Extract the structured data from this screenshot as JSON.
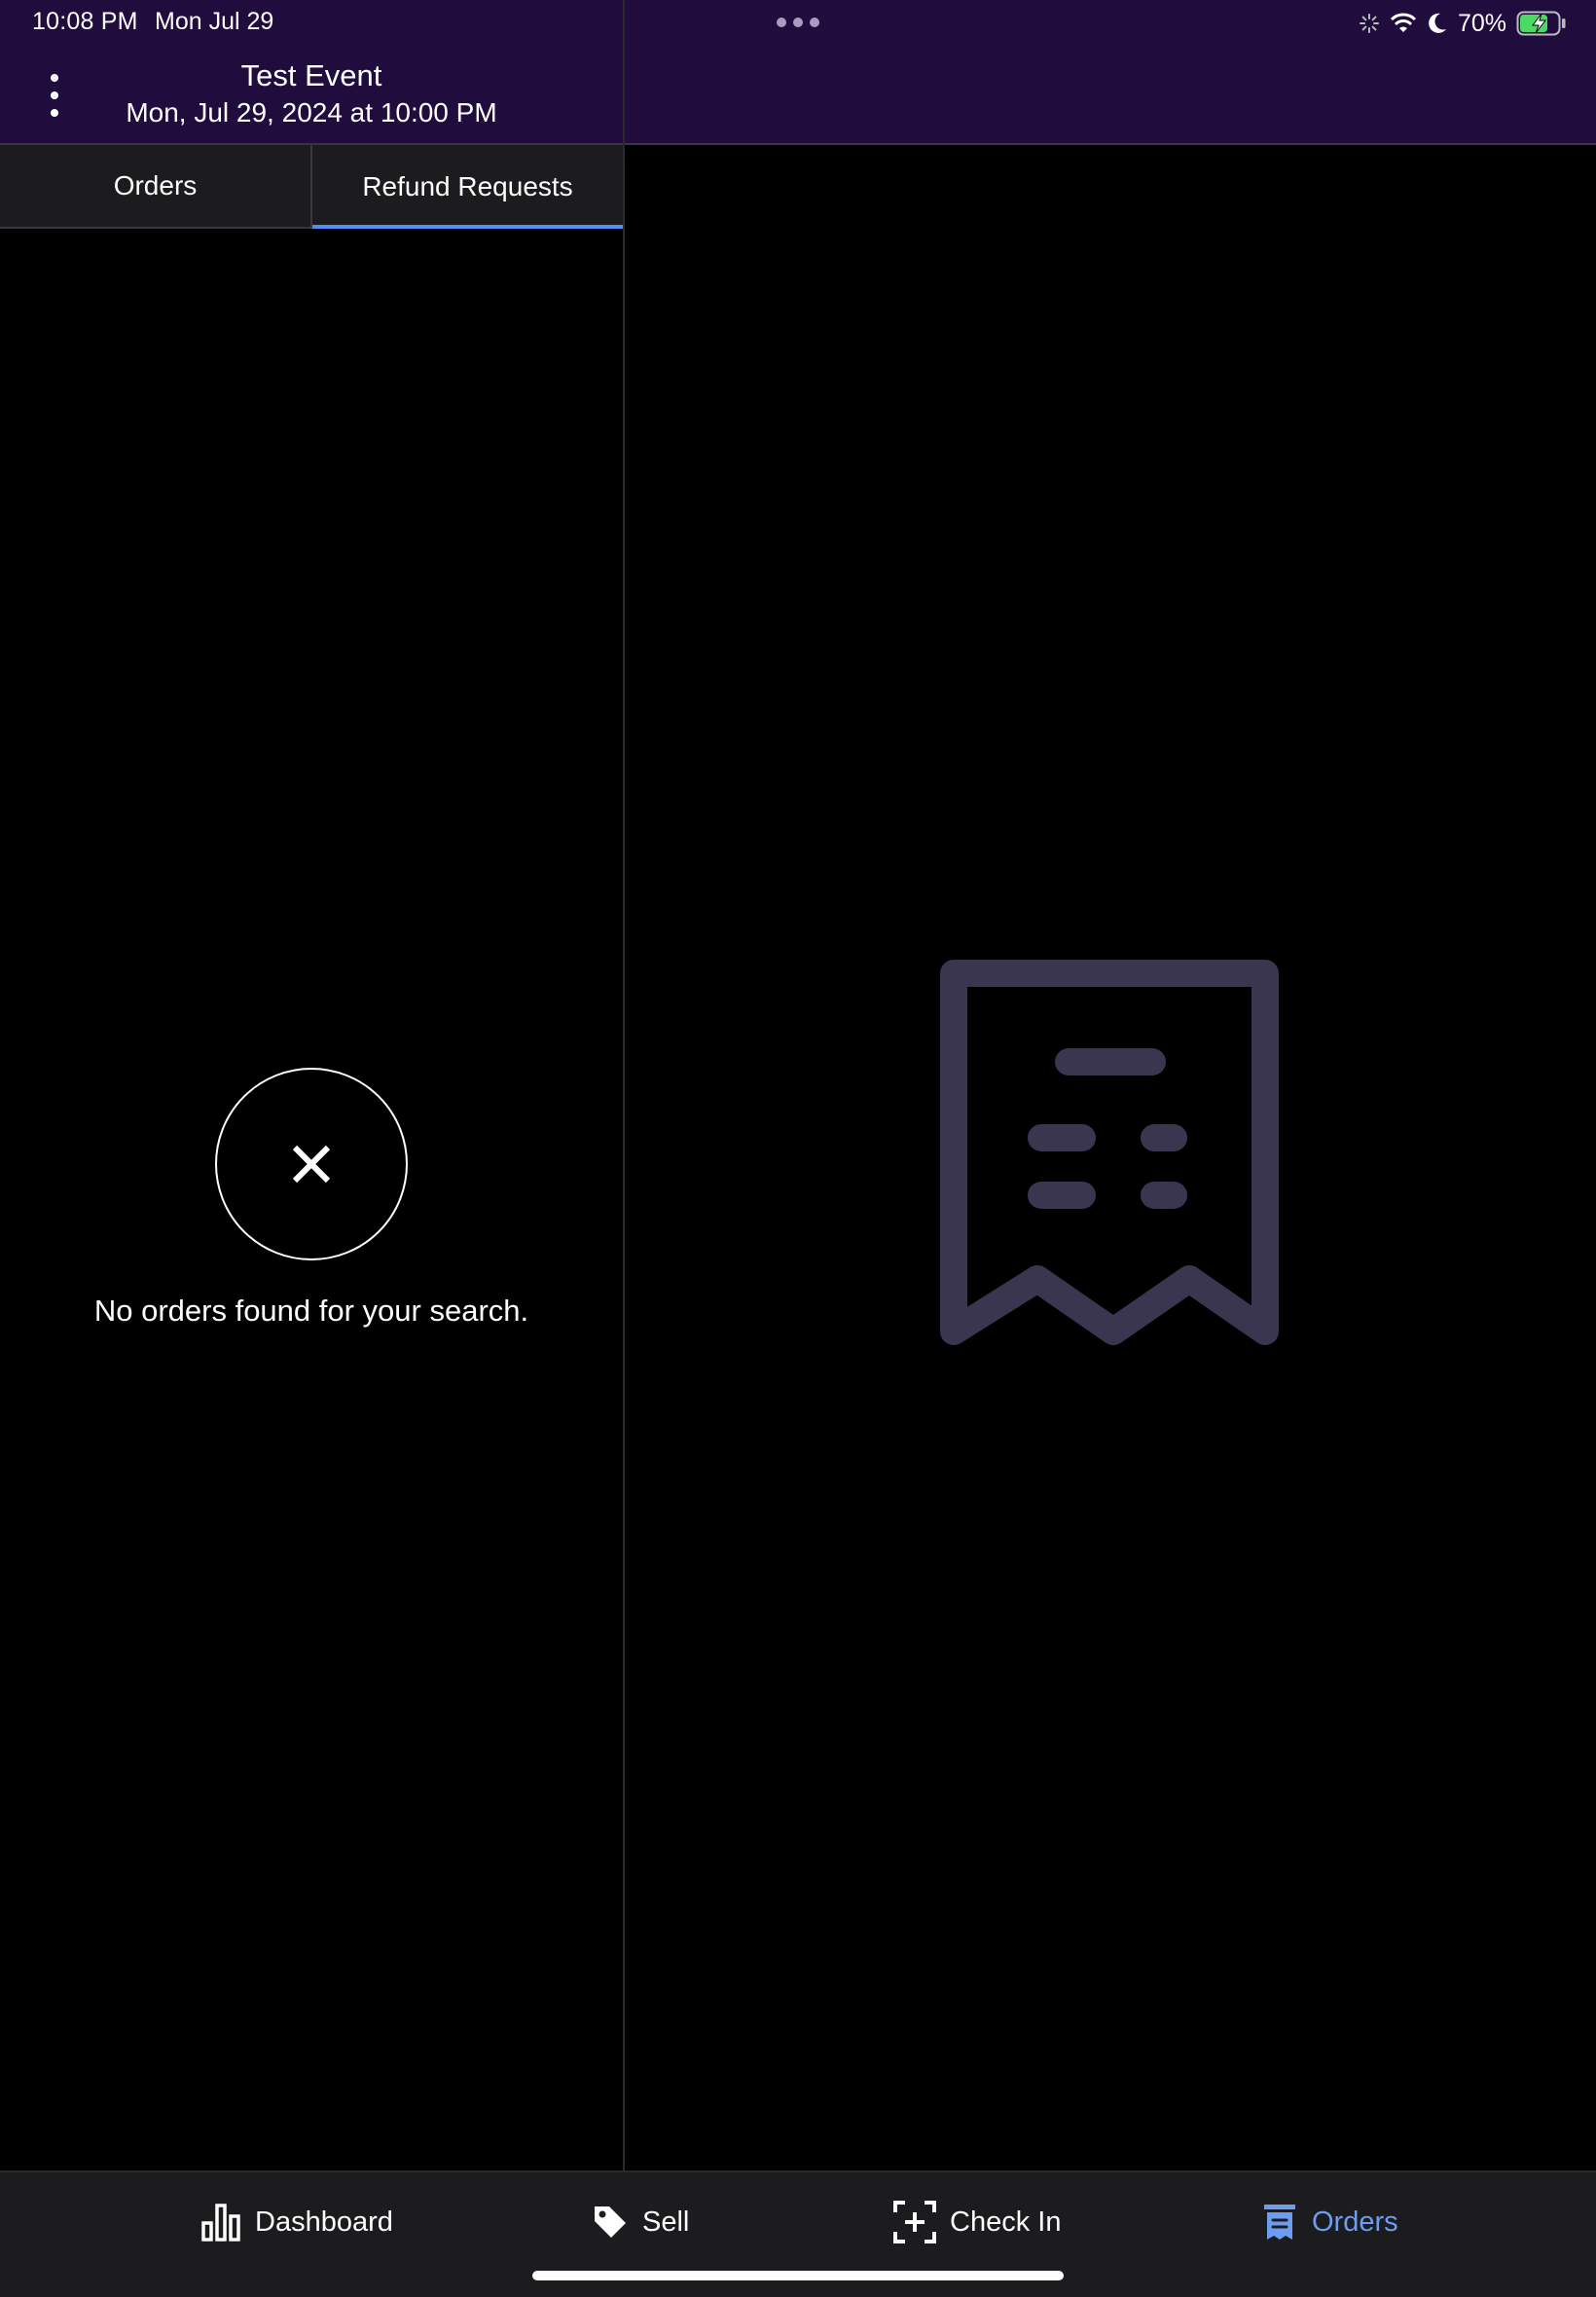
{
  "status_bar": {
    "time": "10:08 PM",
    "date": "Mon Jul 29",
    "battery_percent": "70%",
    "icons": [
      "activity-spinner-icon",
      "wifi-icon",
      "moon-icon",
      "battery-charging-icon"
    ]
  },
  "header": {
    "title": "Test Event",
    "subtitle": "Mon, Jul 29, 2024 at 10:00 PM",
    "menu_icon": "more-vertical-icon"
  },
  "tabs": [
    {
      "label": "Orders",
      "active": false
    },
    {
      "label": "Refund Requests",
      "active": true
    }
  ],
  "empty_state": {
    "icon": "close-icon",
    "message": "No orders found for your search."
  },
  "detail_placeholder": {
    "icon": "receipt-icon"
  },
  "tab_bar": {
    "items": [
      {
        "label": "Dashboard",
        "icon": "bar-chart-icon",
        "active": false
      },
      {
        "label": "Sell",
        "icon": "tag-icon",
        "active": false
      },
      {
        "label": "Check In",
        "icon": "scan-plus-icon",
        "active": false
      },
      {
        "label": "Orders",
        "icon": "orders-icon",
        "active": true
      }
    ]
  },
  "colors": {
    "header_bg": "#200d3d",
    "accent": "#4f8ef7",
    "active_tab_text": "#6d9cf0",
    "illustration": "#3a3650",
    "tabbar_bg": "#1c1c1e"
  }
}
